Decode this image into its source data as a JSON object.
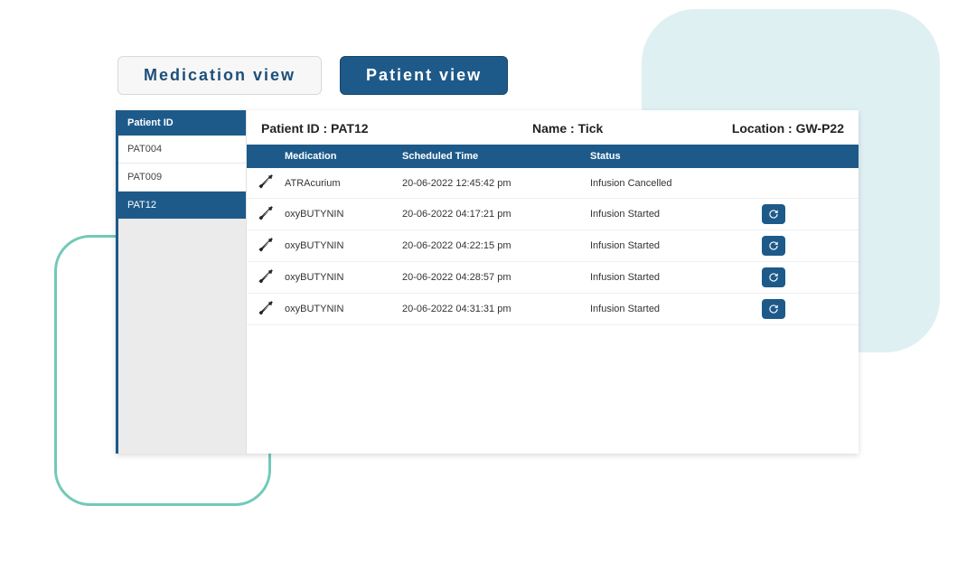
{
  "tabs": {
    "medication_view": "Medication view",
    "patient_view": "Patient view"
  },
  "sidebar": {
    "header": "Patient ID",
    "items": [
      {
        "id": "PAT004"
      },
      {
        "id": "PAT009"
      },
      {
        "id": "PAT12"
      }
    ],
    "selected": "PAT12"
  },
  "info": {
    "patient_id_label": "Patient ID : ",
    "patient_id_value": "PAT12",
    "name_label": "Name : ",
    "name_value": "Tick",
    "location_label": "Location : ",
    "location_value": "GW-P22"
  },
  "columns": {
    "medication": "Medication",
    "scheduled_time": "Scheduled Time",
    "status": "Status"
  },
  "rows": [
    {
      "medication": "ATRAcurium",
      "scheduled_time": "20-06-2022 12:45:42 pm",
      "status": "Infusion Cancelled",
      "has_action": false
    },
    {
      "medication": "oxyBUTYNIN",
      "scheduled_time": "20-06-2022 04:17:21 pm",
      "status": "Infusion Started",
      "has_action": true
    },
    {
      "medication": "oxyBUTYNIN",
      "scheduled_time": "20-06-2022 04:22:15 pm",
      "status": "Infusion Started",
      "has_action": true
    },
    {
      "medication": "oxyBUTYNIN",
      "scheduled_time": "20-06-2022 04:28:57 pm",
      "status": "Infusion Started",
      "has_action": true
    },
    {
      "medication": "oxyBUTYNIN",
      "scheduled_time": "20-06-2022 04:31:31 pm",
      "status": "Infusion Started",
      "has_action": true
    }
  ]
}
